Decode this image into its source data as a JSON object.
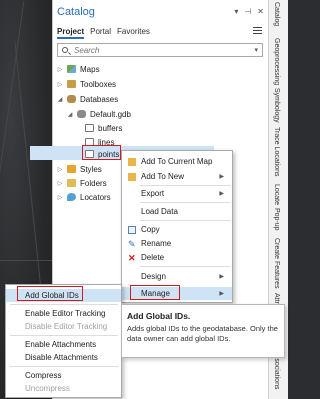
{
  "catalog": {
    "title": "Catalog",
    "tabs": [
      "Project",
      "Portal",
      "Favorites"
    ],
    "search_placeholder": "Search",
    "tree": {
      "maps": "Maps",
      "toolboxes": "Toolboxes",
      "databases": "Databases",
      "gdb": "Default.gdb",
      "buffers": "buffers",
      "lines": "lines",
      "points": "points",
      "styles": "Styles",
      "folders": "Folders",
      "locators": "Locators"
    }
  },
  "side_tabs": [
    "Catalog",
    "Geoprocessing",
    "Symbology",
    "Trace Locations",
    "Locate",
    "Pop-up",
    "Create Features",
    "Attributes",
    "Modify Associations"
  ],
  "context_menu": {
    "add_to_current_map": "Add To Current Map",
    "add_to_new": "Add To New",
    "export": "Export",
    "load_data": "Load Data",
    "copy": "Copy",
    "rename": "Rename",
    "delete": "Delete",
    "design": "Design",
    "manage": "Manage"
  },
  "submenu": {
    "add_global_ids": "Add Global IDs",
    "enable_editor_tracking": "Enable Editor Tracking",
    "disable_editor_tracking": "Disable Editor Tracking",
    "enable_attachments": "Enable Attachments",
    "disable_attachments": "Disable Attachments",
    "compress": "Compress",
    "uncompress": "Uncompress"
  },
  "tooltip": {
    "title": "Add Global IDs.",
    "body": "Adds global IDs to the geodatabase. Only the data owner can add global IDs."
  },
  "colors": {
    "accent": "#2d6bb5",
    "highlight": "#cfe3f6",
    "callout_red": "#d21a1a"
  }
}
